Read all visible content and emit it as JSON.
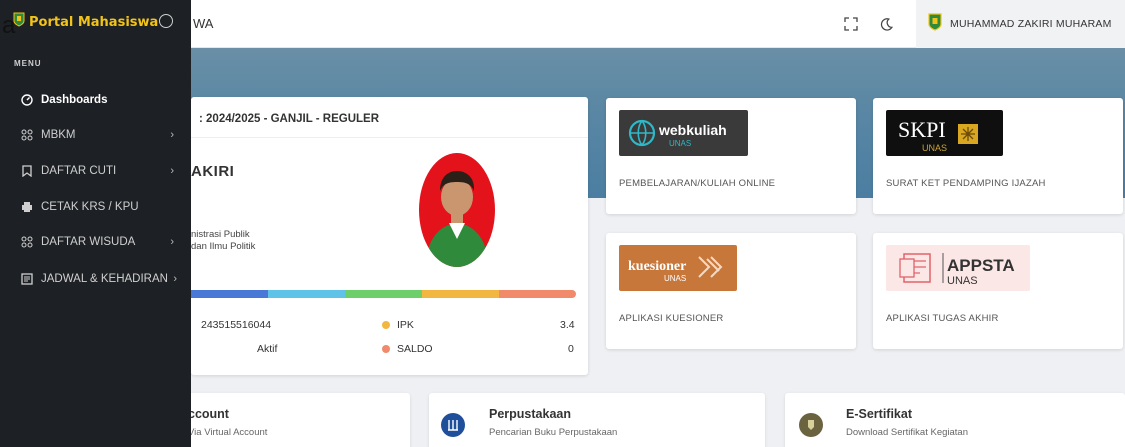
{
  "topbar": {
    "stray_char": "a",
    "title_fragment": "WA",
    "user_name": "MUHAMMAD ZAKIRI MUHARAM",
    "fullscreen_icon": "expand-icon",
    "theme_icon": "moon-icon"
  },
  "sidebar": {
    "brand": "Portal Mahasiswa",
    "menu_label": "MENU",
    "items": [
      {
        "label": "Dashboards",
        "icon": "gauge-icon"
      },
      {
        "label": "MBKM",
        "icon": "grid-icon",
        "chevron": "›"
      },
      {
        "label": "DAFTAR CUTI",
        "icon": "bookmark-icon",
        "chevron": "›"
      },
      {
        "label": "CETAK KRS / KPU",
        "icon": "printer-icon"
      },
      {
        "label": "DAFTAR WISUDA",
        "icon": "grid-icon",
        "chevron": "›"
      },
      {
        "label": "JADWAL & KEHADIRAN",
        "icon": "list-icon",
        "chevron": "›"
      }
    ]
  },
  "profile": {
    "period": ": 2024/2025 - GANJIL - REGULER",
    "name_fragment": "AKIRI",
    "prodi_line1": "nistrasi Publik",
    "prodi_line2": "dan Ilmu Politik",
    "nim": "243515516044",
    "status": "Aktif",
    "ipk_label": "IPK",
    "ipk_value": "3.4",
    "saldo_label": "SALDO",
    "saldo_value": "0",
    "stripe_colors": [
      "#4a78d6",
      "#5ec3e6",
      "#6ccf6a",
      "#f2b740",
      "#f08a6a"
    ]
  },
  "apps": [
    {
      "logo_text": "webkuliah",
      "logo_sub": "UNAS",
      "caption": "PEMBELAJARAN/KULIAH ONLINE"
    },
    {
      "logo_text": "SKPI",
      "logo_sub": "UNAS",
      "caption": "SURAT KET PENDAMPING IJAZAH"
    },
    {
      "logo_text": "kuesioner",
      "logo_sub": "UNAS",
      "caption": "APLIKASI KUESIONER"
    },
    {
      "logo_text": "APPSTA",
      "logo_sub": "UNAS",
      "caption": "APLIKASI TUGAS AKHIR"
    }
  ],
  "bottom": [
    {
      "title": "ccount",
      "subtitle": "Via Virtual Account"
    },
    {
      "title": "Perpustakaan",
      "subtitle": "Pencarian Buku Perpustakaan"
    },
    {
      "title": "E-Sertifikat",
      "subtitle": "Download Sertifikat Kegiatan"
    }
  ],
  "colors": {
    "sidebar_bg": "#1d2024",
    "brand_yellow": "#f2c318",
    "hero": "#5a87a4",
    "dot_ipk": "#f2b740",
    "dot_saldo": "#f08a6a"
  }
}
